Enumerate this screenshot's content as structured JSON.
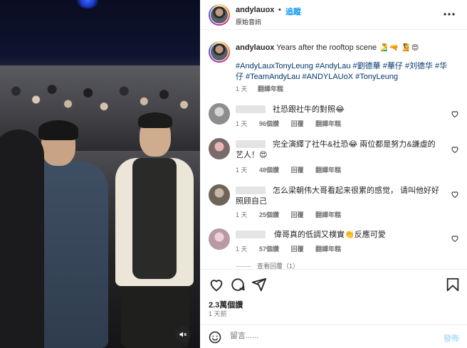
{
  "header": {
    "username": "andylauox",
    "dot": "•",
    "follow_label": "追蹤",
    "subtitle": "原始音訊"
  },
  "caption": {
    "username": "andylauox",
    "text": "Years after the rooftop scene",
    "emojis": "🧏‍♂️ 🔫 🧏 😍",
    "hashtags": "#AndyLauxTonyLeung #AndyLau #劉德華 #華仔 #刘德华 #华仔 #TeamAndyLau #ANDYLAUoX #TonyLeung",
    "time": "1 天",
    "translate_label": "翻譯年糕"
  },
  "comments": [
    {
      "text": "社恐跟社牛的對照😂",
      "time": "1 天",
      "likes": "96個讚",
      "reply_label": "回覆",
      "translate_label": "翻譯年糕"
    },
    {
      "text": "完全演繹了社牛&社恐😂 兩位都是努力&謙虛的艺人！😍",
      "time": "1 天",
      "likes": "48個讚",
      "reply_label": "回覆",
      "translate_label": "翻譯年糕"
    },
    {
      "text": "怎么梁朝伟大哥看起来很累的感觉， 请叫他好好照顾自己",
      "time": "1 天",
      "likes": "25個讚",
      "reply_label": "回覆",
      "translate_label": "翻譯年糕"
    },
    {
      "text": "偉哥真的低調又樸實👏反應可愛",
      "time": "1 天",
      "likes": "57個讚",
      "reply_label": "回覆",
      "translate_label": "翻譯年糕"
    }
  ],
  "more_replies": "查看回覆（1）",
  "stats": {
    "likes": "2.3萬個讚",
    "time_ago": "1 天前"
  },
  "comment_box": {
    "placeholder": "留言......",
    "post_label": "發佈"
  },
  "icons": {
    "like": "heart-icon",
    "comment": "comment-icon",
    "share": "send-icon",
    "save": "bookmark-icon",
    "emoji": "emoji-icon",
    "more": "more-icon",
    "mute": "mute-icon"
  },
  "colors": {
    "link_blue": "#0095f6",
    "hashtag_blue": "#00376b",
    "muted_text": "#737373",
    "post_disabled": "#b2dffc"
  }
}
